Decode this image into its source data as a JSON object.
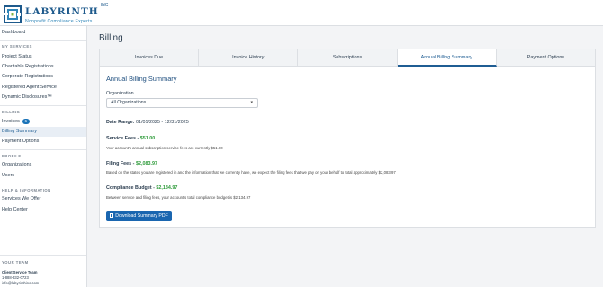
{
  "brand": {
    "name": "LABYRINTH",
    "suffix": "INC",
    "tagline": "Nonprofit Compliance Experts",
    "colors": {
      "primary": "#1e5a8c",
      "accent": "#2f86b9"
    }
  },
  "sidebar": {
    "dashboard": "Dashboard",
    "sections": {
      "services": "MY SERVICES",
      "billing": "BILLING",
      "profile": "PROFILE",
      "help": "HELP & INFORMATION",
      "team": "YOUR TEAM"
    },
    "services_items": [
      "Project Status",
      "Charitable Registrations",
      "Corporate Registrations",
      "Registered Agent Service",
      "Dynamic Disclosures™"
    ],
    "billing_items": [
      "Invoices",
      "Billing Summary",
      "Payment Options"
    ],
    "invoices_badge": "6",
    "profile_items": [
      "Organizations",
      "Users"
    ],
    "help_items": [
      "Services We Offer",
      "Help Center"
    ],
    "team": {
      "name": "Client Service Team",
      "phone": "1-888-332-0723",
      "email": "info@labyrinthinc.com"
    }
  },
  "page": {
    "title": "Billing"
  },
  "tabs": [
    "Invoices Due",
    "Invoice History",
    "Subscriptions",
    "Annual Billing Summary",
    "Payment Options"
  ],
  "summary": {
    "title": "Annual Billing Summary",
    "org_label": "Organization",
    "org_selected": "All Organizations",
    "date_range_label": "Date Range:",
    "date_range_value": "01/01/2025 - 12/31/2025",
    "service_fees_label": "Service Fees -",
    "service_fees_value": "$51.00",
    "service_fees_note": "Your account's annual subscription service fees are currently $51.00",
    "filing_fees_label": "Filing Fees -",
    "filing_fees_value": "$2,083.97",
    "filing_fees_note": "Based on the states you are registered in and the information that we currently have, we expect the filing fees that we pay on your behalf to total approximately $2,083.97",
    "budget_label": "Compliance Budget -",
    "budget_value": "$2,134.97",
    "budget_note": "Between service and filing fees, your account's total compliance budget is $2,134.97",
    "download_label": "Download Summary PDF"
  }
}
